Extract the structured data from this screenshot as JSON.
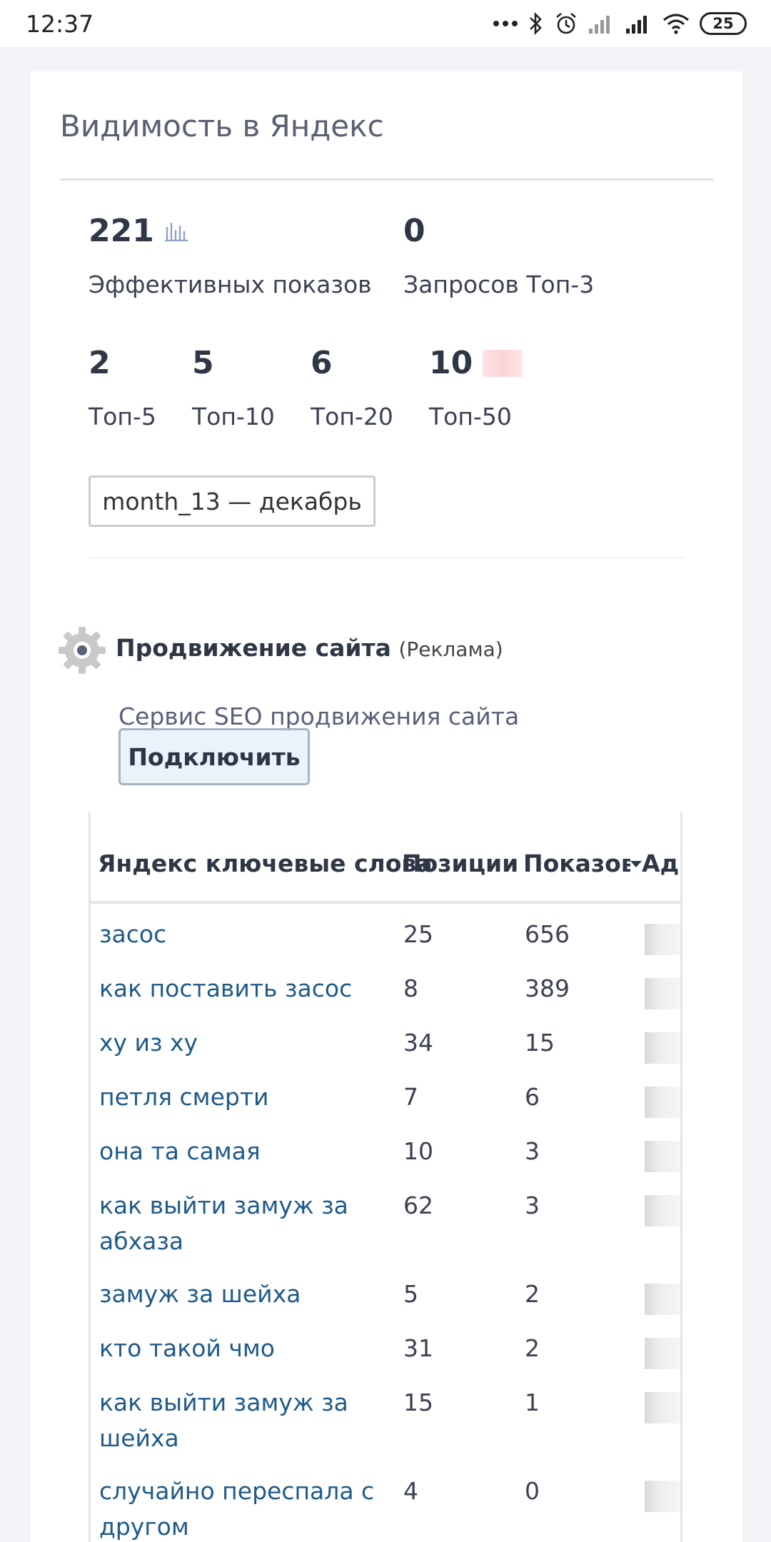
{
  "status_bar": {
    "time": "12:37",
    "battery": "25",
    "icons": [
      "dots-icon",
      "bluetooth-icon",
      "alarm-icon",
      "signal-icon",
      "signal-icon",
      "wifi-icon",
      "battery-icon"
    ]
  },
  "card": {
    "title": "Видимость в Яндекс"
  },
  "metrics": {
    "effective_value": "221",
    "effective_label": "Эффективных показов",
    "top3_value": "0",
    "top3_label": "Запросов Топ-3",
    "top5_value": "2",
    "top5_label": "Топ-5",
    "top10_value": "5",
    "top10_label": "Топ-10",
    "top20_value": "6",
    "top20_label": "Топ-20",
    "top50_value": "10",
    "top50_label": "Топ-50"
  },
  "period_select": {
    "value": "month_13 — декабрь"
  },
  "promo": {
    "title": "Продвижение сайта",
    "tag": "(Реклама)",
    "description": "Сервис SEO продвижения сайта",
    "button_label": "Подключить"
  },
  "table": {
    "headers": [
      "Яндекс ключевые слова",
      "Позиции",
      "Показов",
      "Ад"
    ],
    "rows": [
      {
        "keyword": "засос",
        "position": "25",
        "impressions": "656"
      },
      {
        "keyword": "как поставить засос",
        "position": "8",
        "impressions": "389"
      },
      {
        "keyword": "ху из ху",
        "position": "34",
        "impressions": "15"
      },
      {
        "keyword": "петля смерти",
        "position": "7",
        "impressions": "6"
      },
      {
        "keyword": "она та самая",
        "position": "10",
        "impressions": "3"
      },
      {
        "keyword": "как выйти замуж за абхаза",
        "position": "62",
        "impressions": "3"
      },
      {
        "keyword": "замуж за шейха",
        "position": "5",
        "impressions": "2"
      },
      {
        "keyword": "кто такой чмо",
        "position": "31",
        "impressions": "2"
      },
      {
        "keyword": "как выйти замуж за шейха",
        "position": "15",
        "impressions": "1"
      },
      {
        "keyword": "случайно переспала с другом",
        "position": "4",
        "impressions": "0"
      }
    ]
  },
  "colors": {
    "link": "#1f5a8a",
    "heading": "#2f3747",
    "button_bg": "#e9f3fb"
  }
}
